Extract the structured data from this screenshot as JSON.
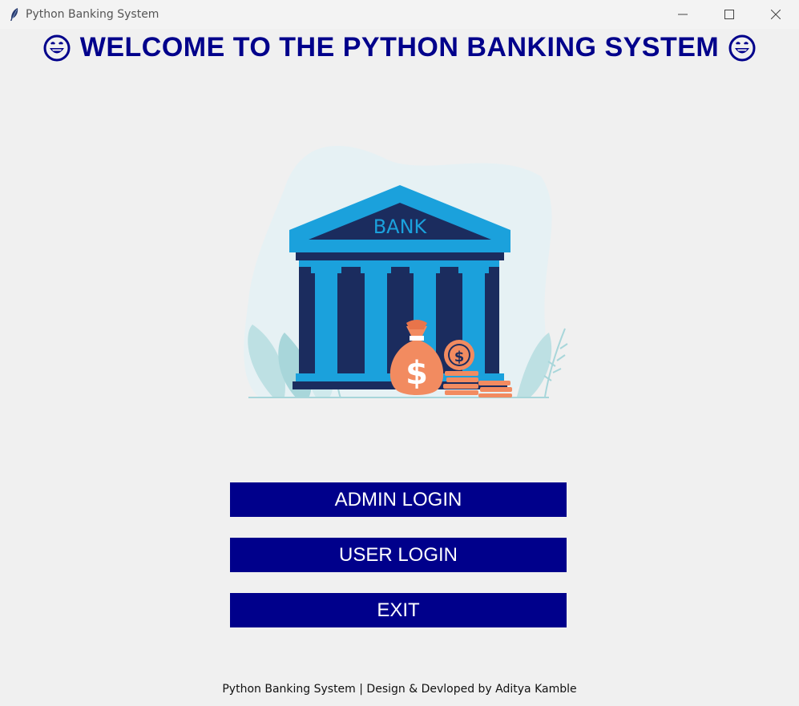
{
  "window": {
    "title": "Python Banking System"
  },
  "header": {
    "welcome_text": "WELCOME TO THE PYTHON BANKING SYSTEM",
    "emoji_icon": "grinning-face-icon"
  },
  "hero": {
    "bank_label": "BANK",
    "dollar_symbol": "$"
  },
  "buttons": {
    "admin_login": "ADMIN LOGIN",
    "user_login": "USER LOGIN",
    "exit": "EXIT"
  },
  "footer": {
    "text": "Python Banking System | Design & Devloped by Aditya Kamble"
  },
  "colors": {
    "accent": "#00008b",
    "background": "#f0f0f0",
    "button_text": "#ffffff",
    "bank_roof": "#1ba1dc",
    "bank_dark": "#1b2c5e",
    "money_orange": "#f28b60"
  }
}
